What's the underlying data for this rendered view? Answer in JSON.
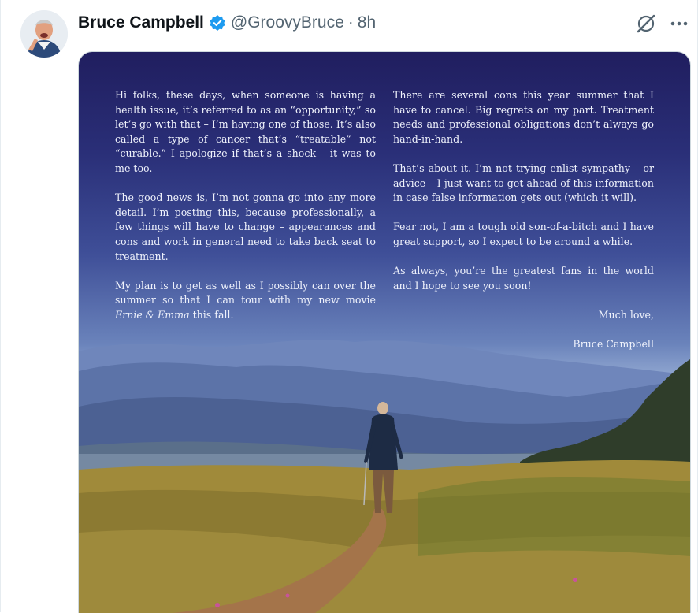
{
  "post": {
    "display_name": "Bruce Campbell",
    "handle": "@GroovyBruce",
    "separator": "·",
    "time": "8h"
  },
  "image_text": {
    "left": {
      "p1": "Hi folks, these days, when someone is having a health issue, it’s referred to as an “opportunity,” so let’s go with that – I’m having one of those. It’s also called a type of cancer that’s “treatable” not “curable.” I apologize if that’s a shock – it was to me too.",
      "p2": "The good news is, I’m not gonna go into any more detail. I’m posting this, because professionally, a few things will have to change – appearances and cons and work in general need to take back seat to treatment.",
      "p3_a": "My plan is to get as well as I possibly can over the summer so that I can tour with my new movie ",
      "p3_title": "Ernie & Emma",
      "p3_b": " this fall."
    },
    "right": {
      "p1": "There are several cons this year summer that I have to cancel. Big regrets on my part. Treatment needs and professional obligations don’t always go hand-in-hand.",
      "p2": "That’s about it. I’m not trying enlist sympathy – or advice – I just want to get ahead of this information in case false information gets out (which it will).",
      "p3": "Fear not, I am a tough old son-of-a-bitch and I have great support, so I expect to be around a while.",
      "p4": "As always, you’re the greatest fans in the world and I hope to see you soon!",
      "closing": "Much love,",
      "signature": "Bruce Campbell"
    }
  },
  "icons": {
    "verified": "verified-badge-icon",
    "grok": "grok-icon",
    "more": "more-options-icon"
  },
  "colors": {
    "verified_blue": "#1d9bf0",
    "name": "#0f1419",
    "secondary": "#536471",
    "sky_top": "#201e5f",
    "sky_horizon": "#b8c8df"
  }
}
